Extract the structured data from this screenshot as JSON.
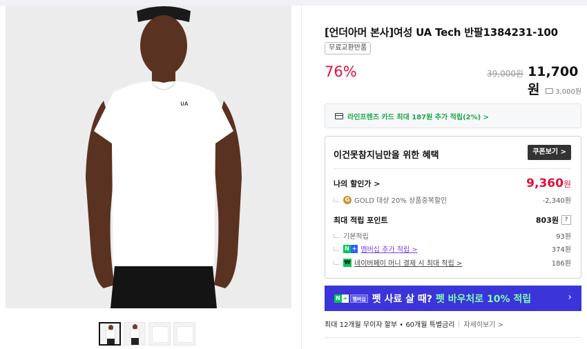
{
  "product": {
    "title": "[언더아머 본사]여성 UA Tech 반팔1384231-100",
    "badge": "무료교환반품",
    "discount_rate": "76%",
    "original_price": "39,000원",
    "sale_price": "11,700원",
    "shipping": "3,000원"
  },
  "card_banner": {
    "text": "라인프렌즈 카드 최대 187원 추가 적립(2%) >"
  },
  "benefit": {
    "heading": "이건못참지님만을 위한 혜택",
    "coupon_button": "쿠폰보기 >",
    "my_price_label": "나의 할인가 >",
    "my_price_value": "9,360",
    "my_price_unit": "원",
    "gold_label": "GOLD 대상 20% 상품중복할인",
    "gold_value": "-2,340원",
    "points_label": "최대 적립 포인트",
    "points_value": "803원",
    "help_icon": "?",
    "basic_label": "기본적립",
    "basic_value": "93원",
    "membership_label": "멤버십 추가 적립 >",
    "membership_value": "374원",
    "npay_label": "네이버페이 머니 결제 시 최대 적립 >",
    "npay_value": "186원"
  },
  "promo": {
    "badge_n": "N",
    "badge_plus": "+",
    "badge_membership": "멤버십",
    "text": "펫 사료 살 때?",
    "highlight": "펫 바우처로 10% 적립",
    "chevron": "›"
  },
  "installment": {
    "text": "최대 12개월 무이자 할부 • 60개월 특별금리",
    "more": "자세히보기 >"
  },
  "icons": {
    "gold": "G",
    "npay": "₩",
    "n": "N",
    "plus": "+"
  },
  "colors": {
    "discount_red": "#e0103a",
    "naver_green": "#03c75a",
    "promo_blue": "#3a34d9",
    "membership_purple": "#7b3fe4"
  }
}
